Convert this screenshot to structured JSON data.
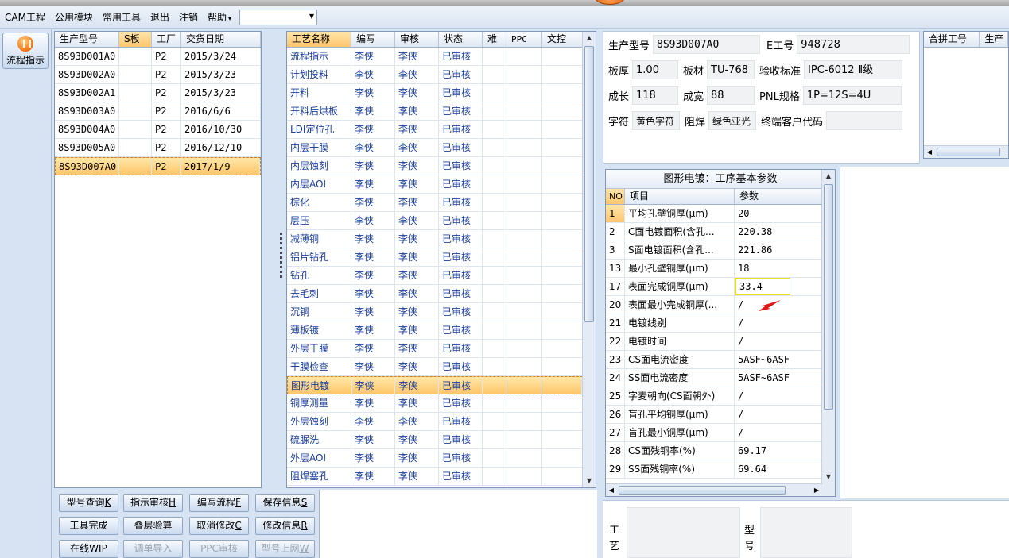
{
  "menu": {
    "items": [
      "CAM工程",
      "公用模块",
      "常用工具",
      "退出",
      "注销",
      "帮助"
    ],
    "help_caret": "▾"
  },
  "left_toolbar": {
    "flow_label": "流程指示"
  },
  "products": {
    "columns": [
      "生产型号",
      "S板",
      "工厂",
      "交货日期"
    ],
    "rows": [
      [
        "8S93D001A0",
        "",
        "P2",
        "2015/3/24"
      ],
      [
        "8S93D002A0",
        "",
        "P2",
        "2015/3/23"
      ],
      [
        "8S93D002A1",
        "",
        "P2",
        "2015/3/23"
      ],
      [
        "8S93D003A0",
        "",
        "P2",
        "2016/6/6"
      ],
      [
        "8S93D004A0",
        "",
        "P2",
        "2016/10/30"
      ],
      [
        "8S93D005A0",
        "",
        "P2",
        "2016/12/10"
      ],
      [
        "8S93D007A0",
        "",
        "P2",
        "2017/1/9"
      ]
    ],
    "selected_index": 6
  },
  "process": {
    "columns": [
      "工艺名称",
      "编写",
      "审核",
      "状态",
      "难",
      "PPC",
      "文控"
    ],
    "rows": [
      [
        "流程指示",
        "李侠",
        "李侠",
        "已审核"
      ],
      [
        "计划投料",
        "李侠",
        "李侠",
        "已审核"
      ],
      [
        "开料",
        "李侠",
        "李侠",
        "已审核"
      ],
      [
        "开料后烘板",
        "李侠",
        "李侠",
        "已审核"
      ],
      [
        "LDI定位孔",
        "李侠",
        "李侠",
        "已审核"
      ],
      [
        "内层干膜",
        "李侠",
        "李侠",
        "已审核"
      ],
      [
        "内层蚀刻",
        "李侠",
        "李侠",
        "已审核"
      ],
      [
        "内层AOI",
        "李侠",
        "李侠",
        "已审核"
      ],
      [
        "棕化",
        "李侠",
        "李侠",
        "已审核"
      ],
      [
        "层压",
        "李侠",
        "李侠",
        "已审核"
      ],
      [
        "减薄铜",
        "李侠",
        "李侠",
        "已审核"
      ],
      [
        "铝片钻孔",
        "李侠",
        "李侠",
        "已审核"
      ],
      [
        "钻孔",
        "李侠",
        "李侠",
        "已审核"
      ],
      [
        "去毛刺",
        "李侠",
        "李侠",
        "已审核"
      ],
      [
        "沉铜",
        "李侠",
        "李侠",
        "已审核"
      ],
      [
        "薄板镀",
        "李侠",
        "李侠",
        "已审核"
      ],
      [
        "外层干膜",
        "李侠",
        "李侠",
        "已审核"
      ],
      [
        "干膜检查",
        "李侠",
        "李侠",
        "已审核"
      ],
      [
        "图形电镀",
        "李侠",
        "李侠",
        "已审核"
      ],
      [
        "铜厚测量",
        "李侠",
        "李侠",
        "已审核"
      ],
      [
        "外层蚀刻",
        "李侠",
        "李侠",
        "已审核"
      ],
      [
        "硫脲洗",
        "李侠",
        "李侠",
        "已审核"
      ],
      [
        "外层AOI",
        "李侠",
        "李侠",
        "已审核"
      ],
      [
        "阻焊塞孔",
        "李侠",
        "李侠",
        "已审核"
      ]
    ],
    "selected_index": 18
  },
  "buttons": [
    {
      "label": "型号查询",
      "key": "K",
      "disabled": false
    },
    {
      "label": "指示审核",
      "key": "H",
      "disabled": false
    },
    {
      "label": "编写流程",
      "key": "F",
      "disabled": false
    },
    {
      "label": "保存信息",
      "key": "S",
      "disabled": false
    },
    {
      "label": "工具完成",
      "key": "",
      "disabled": false
    },
    {
      "label": "叠层验算",
      "key": "",
      "disabled": false
    },
    {
      "label": "取消修改",
      "key": "C",
      "disabled": false
    },
    {
      "label": "修改信息",
      "key": "R",
      "disabled": false
    },
    {
      "label": "在线WIP",
      "key": "",
      "disabled": false
    },
    {
      "label": "调单导入",
      "key": "",
      "disabled": true
    },
    {
      "label": "PPC审核",
      "key": "",
      "disabled": true
    },
    {
      "label": "型号上网",
      "key": "W",
      "disabled": true
    }
  ],
  "info": {
    "part_no_label": "生产型号",
    "part_no": "8S93D007A0",
    "e_no_label": "E工号",
    "e_no": "948728",
    "thickness_label": "板厚",
    "thickness": "1.00",
    "material_label": "板材",
    "material": "TU-768",
    "standard_label": "验收标准",
    "standard": "IPC-6012 Ⅱ级",
    "length_label": "成长",
    "length": "118",
    "width_label": "成宽",
    "width": "88",
    "pnl_label": "PNL规格",
    "pnl": "1P=12S=4U",
    "char_label": "字符",
    "char": "黄色字符",
    "mask_label": "阻焊",
    "mask": "绿色亚光",
    "endcode_label": "终端客户代码",
    "endcode": ""
  },
  "merge": {
    "columns": [
      "合拼工号",
      "生产"
    ]
  },
  "params": {
    "title": "图形电镀：工序基本参数",
    "columns": [
      "NO",
      "项目",
      "参数"
    ],
    "rows": [
      [
        "1",
        "平均孔壁铜厚(μm)",
        "20"
      ],
      [
        "2",
        "C面电镀面积(含孔...",
        "220.38"
      ],
      [
        "3",
        "S面电镀面积(含孔...",
        "221.86"
      ],
      [
        "13",
        "最小孔壁铜厚(μm)",
        "18"
      ],
      [
        "17",
        "表面完成铜厚(μm)",
        "33.4"
      ],
      [
        "20",
        "表面最小完成铜厚(...",
        "/"
      ],
      [
        "21",
        "电镀线别",
        "/"
      ],
      [
        "22",
        "电镀时间",
        "/"
      ],
      [
        "23",
        "CS面电流密度",
        "5ASF~6ASF"
      ],
      [
        "24",
        "SS面电流密度",
        "5ASF~6ASF"
      ],
      [
        "25",
        "字麦朝向(CS面朝外)",
        "/"
      ],
      [
        "26",
        "盲孔平均铜厚(μm)",
        "/"
      ],
      [
        "27",
        "盲孔最小铜厚(μm)",
        "/"
      ],
      [
        "28",
        "CS面残铜率(%)",
        "69.17"
      ],
      [
        "29",
        "SS面残铜率(%)",
        "69.64"
      ]
    ],
    "editing_index": 4
  },
  "bottom_right": {
    "label_a": "工艺",
    "label_b": "型号"
  }
}
